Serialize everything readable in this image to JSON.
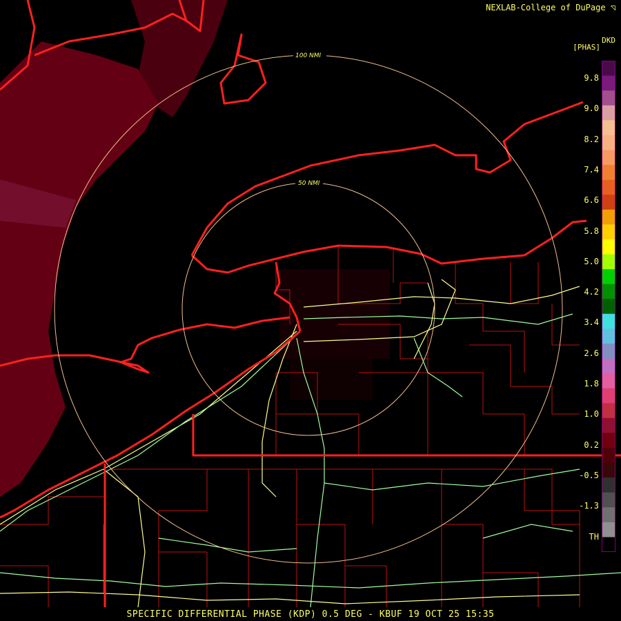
{
  "header": {
    "credit": "NEXLAB-College of DuPage ◹"
  },
  "footer": {
    "caption": "SPECIFIC DIFFERENTIAL PHASE (KDP) 0.5 DEG - KBUF 19 OCT 25 15:35"
  },
  "legend": {
    "product_code": "DKD",
    "unit": "[PHAS]",
    "ticks": [
      "9.8",
      "9.0",
      "8.2",
      "7.4",
      "6.6",
      "5.8",
      "5.0",
      "4.2",
      "3.4",
      "2.6",
      "1.8",
      "1.0",
      "0.2",
      "-0.5",
      "-1.3",
      "TH"
    ],
    "colors": [
      "#4a0a4a",
      "#7a1a7a",
      "#a0508a",
      "#d9a0a0",
      "#f4c090",
      "#f7b080",
      "#f59a60",
      "#f08030",
      "#e86020",
      "#d04010",
      "#f0a000",
      "#ffd000",
      "#ffff00",
      "#a0ff00",
      "#00d000",
      "#009000",
      "#006000",
      "#40e0e0",
      "#60c0e0",
      "#8090c0",
      "#c070c0",
      "#e060a0",
      "#e04070",
      "#c03040",
      "#901030",
      "#700010",
      "#500008",
      "#380808",
      "#303030",
      "#505050",
      "#707070",
      "#909090",
      "#000000"
    ]
  },
  "rings": [
    {
      "label": "50 NMI"
    },
    {
      "label": "100 NMI"
    }
  ],
  "colors": {
    "background": "#000000",
    "echo": "#6a0015",
    "state_border": "#ff2020",
    "county_border": "#c01010",
    "highway": "#ffff90",
    "highway_alt": "#a0ffa0",
    "ring": "#f0c090"
  }
}
